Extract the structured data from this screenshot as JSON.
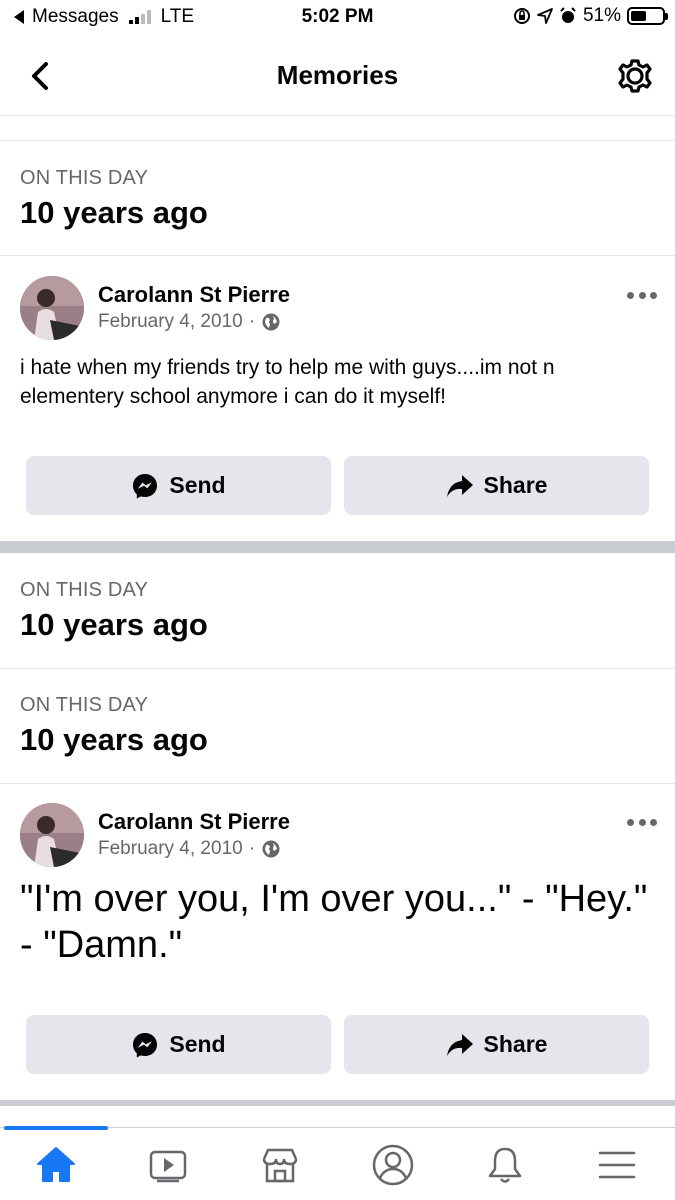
{
  "status_bar": {
    "back_app": "Messages",
    "network": "LTE",
    "time": "5:02 PM",
    "battery": "51%",
    "battery_level": 0.51
  },
  "header": {
    "title": "Memories",
    "back_icon": "chevron-left-icon",
    "settings_icon": "gear-icon"
  },
  "sections": [
    {
      "label": "ON THIS DAY",
      "years": "10 years ago"
    },
    {
      "label": "ON THIS DAY",
      "years": "10 years ago"
    },
    {
      "label": "ON THIS DAY",
      "years": "10 years ago"
    }
  ],
  "posts": [
    {
      "author": "Carolann St Pierre",
      "date": "February 4, 2010",
      "separator": "·",
      "privacy_icon": "globe-icon",
      "text": "i hate when my friends try to help me with guys....im not n elementery school anymore i can do it myself!"
    },
    {
      "author": "Carolann St Pierre",
      "date": "February 4, 2010",
      "separator": "·",
      "privacy_icon": "globe-icon",
      "text": "\"I'm over you, I'm over you...\" - \"Hey.\" - \"Damn.\""
    }
  ],
  "actions": {
    "send_label": "Send",
    "share_label": "Share"
  },
  "tabbar": {
    "items": [
      "home-icon",
      "video-icon",
      "marketplace-icon",
      "profile-icon",
      "notifications-icon",
      "menu-icon"
    ],
    "active": "home-icon"
  },
  "colors": {
    "accent": "#1877f2",
    "button_bg": "#e4e6eb",
    "secondary_text": "#65676b"
  }
}
